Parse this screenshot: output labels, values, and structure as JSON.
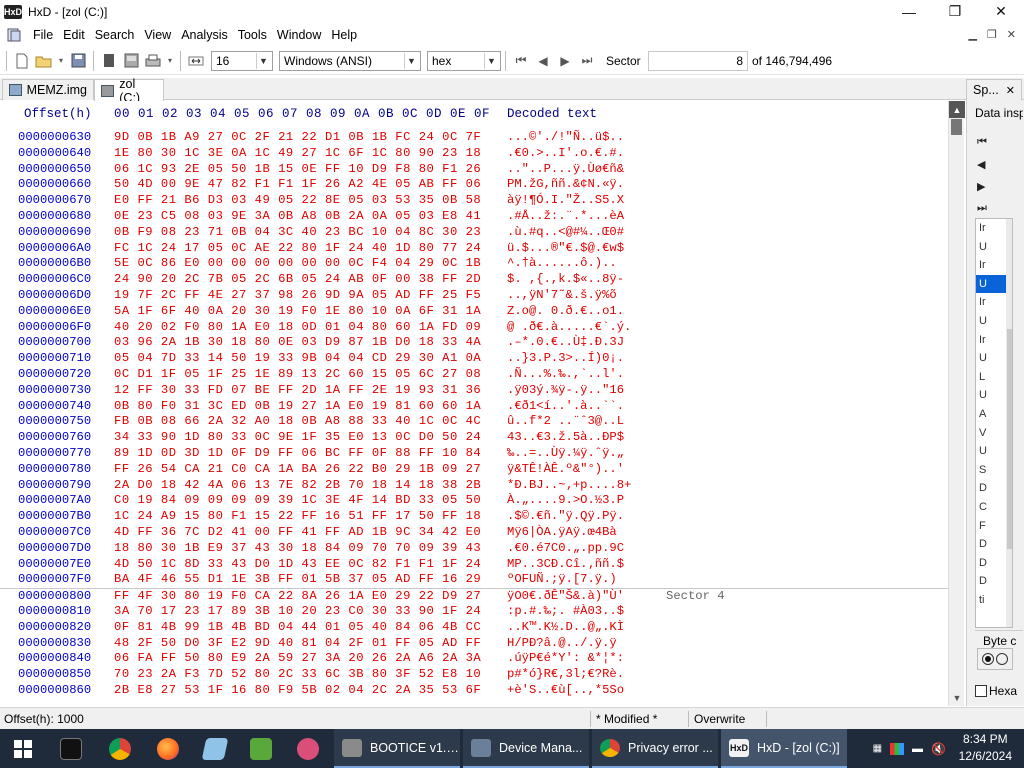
{
  "window": {
    "title": "HxD - [zol (C:)]",
    "app_icon": "HxD",
    "min_glyph": "—",
    "max_glyph": "❐",
    "close_glyph": "✕"
  },
  "menu": [
    "File",
    "Edit",
    "Search",
    "View",
    "Analysis",
    "Tools",
    "Window",
    "Help"
  ],
  "toolbar": {
    "bytes_per_row": "16",
    "charset": "Windows (ANSI)",
    "display_mode": "hex",
    "unit_label": "Sector",
    "sector_value": "8",
    "sector_total": "of 146,794,496"
  },
  "tabs": [
    {
      "label": "MEMZ.img",
      "active": false
    },
    {
      "label": "zol (C:)",
      "active": true
    }
  ],
  "side_tab": {
    "label": "Sp...",
    "close": "✕"
  },
  "editor": {
    "header_offset": "Offset(h)",
    "header_cols": "00 01 02 03 04 05 06 07 08 09 0A 0B 0C 0D 0E 0F",
    "header_text": "Decoded text",
    "rows": [
      {
        "off": "0000000630",
        "hex": "9D 0B 1B A9 27 0C 2F 21 22 D1 0B 1B FC 24 0C 7F",
        "txt": "...©'./!\"Ñ..ü$..",
        "cmt": ""
      },
      {
        "off": "0000000640",
        "hex": "1E 80 30 1C 3E 0A 1C 49 27 1C 6F 1C 80 90 23 18",
        "txt": ".€0.>..I'.o.€.#.",
        "cmt": ""
      },
      {
        "off": "0000000650",
        "hex": "06 1C 93 2E 05 50 1B 15 0E FF 10 D9 F8 80 F1 26",
        "txt": "..\"..P...ÿ.Ùø€ñ&",
        "cmt": ""
      },
      {
        "off": "0000000660",
        "hex": "50 4D 00 9E 47 82 F1 F1 1F 26 A2 4E 05 AB FF 06",
        "txt": "PM.žG,ññ.&¢N.«ÿ.",
        "cmt": ""
      },
      {
        "off": "0000000670",
        "hex": "E0 FF 21 B6 D3 03 49 05 22 8E 05 03 53 35 0B 58",
        "txt": "àÿ!¶Ó.I.\"Ž..S5.X",
        "cmt": ""
      },
      {
        "off": "0000000680",
        "hex": "0E 23 C5 08 03 9E 3A 0B A8 0B 2A 0A 05 03 E8 41",
        "txt": ".#Å..ž:.¨.*...èA",
        "cmt": ""
      },
      {
        "off": "0000000690",
        "hex": "0B F9 08 23 71 0B 04 3C 40 23 BC 10 04 8C 30 23",
        "txt": ".ù.#q..<@#¼..Œ0#",
        "cmt": ""
      },
      {
        "off": "00000006A0",
        "hex": "FC 1C 24 17 05 0C AE 22 80 1F 24 40 1D 80 77 24",
        "txt": "ü.$...®\"€.$@.€w$",
        "cmt": ""
      },
      {
        "off": "00000006B0",
        "hex": "5E 0C 86 E0 00 00 00 00 00 00 0C F4 04 29 0C 1B",
        "txt": "^.†à......ô.)..",
        "cmt": ""
      },
      {
        "off": "00000006C0",
        "hex": "24 90 20 2C 7B 05 2C 6B 05 24 AB 0F 00 38 FF 2D",
        "txt": "$. ,{.,k.$«..8ÿ-",
        "cmt": ""
      },
      {
        "off": "00000006D0",
        "hex": "19 7F 2C FF 4E 27 37 98 26 9D 9A 05 AD FF 25 F5",
        "txt": "..,ÿN'7˜&.š.­ÿ%õ",
        "cmt": ""
      },
      {
        "off": "00000006E0",
        "hex": "5A 1F 6F 40 0A 20 30 19 F0 1E 80 10 0A 6F 31 1A",
        "txt": "Z.o@. 0.ð.€..o1.",
        "cmt": ""
      },
      {
        "off": "00000006F0",
        "hex": "40 20 02 F0 80 1A E0 18 0D 01 04 80 60 1A FD 09",
        "txt": "@ .ð€.à.....€`.ý.",
        "cmt": ""
      },
      {
        "off": "0000000700",
        "hex": "03 96 2A 1B 30 18 80 0E 03 D9 87 1B D0 18 33 4A",
        "txt": ".–*.0.€..Ù‡.Ð.3J",
        "cmt": ""
      },
      {
        "off": "0000000710",
        "hex": "05 04 7D 33 14 50 19 33 9B 04 04 CD 29 30 A1 0A",
        "txt": "..}3.P.3>..Í)0¡.",
        "cmt": ""
      },
      {
        "off": "0000000720",
        "hex": "0C D1 1F 05 1F 25 1E 89 13 2C 60 15 05 6C 27 08",
        "txt": ".Ñ...%.‰.,`..l'.",
        "cmt": ""
      },
      {
        "off": "0000000730",
        "hex": "12 FF 30 33 FD 07 BE FF 2D 1A FF 2E 19 93 31 36",
        "txt": ".ÿ03ý.¾ÿ-.ÿ..\"16",
        "cmt": ""
      },
      {
        "off": "0000000740",
        "hex": "0B 80 F0 31 3C ED 0B 19 27 1A E0 19 81 60 60 1A",
        "txt": ".€ð1<í..'.à..``.",
        "cmt": ""
      },
      {
        "off": "0000000750",
        "hex": "FB 0B 08 66 2A 32 A0 18 0B A8 88 33 40 1C 0C 4C",
        "txt": "û..f*2 ..¨ˆ3@..L",
        "cmt": ""
      },
      {
        "off": "0000000760",
        "hex": "34 33 90 1D 80 33 0C 9E 1F 35 E0 13 0C D0 50 24",
        "txt": "43..€3.ž.5à..ÐP$",
        "cmt": ""
      },
      {
        "off": "0000000770",
        "hex": "89 1D 0D 3D 1D 0F D9 FF 06 BC FF 0F 88 FF 10 84",
        "txt": "‰..=..Ùÿ.¼ÿ.ˆÿ.„",
        "cmt": ""
      },
      {
        "off": "0000000780",
        "hex": "FF 26 54 CA 21 C0 CA 1A BA 26 22 B0 29 1B 09 27",
        "txt": "ÿ&TÊ!ÀÊ.º&\"°)..'",
        "cmt": ""
      },
      {
        "off": "0000000790",
        "hex": "2A D0 18 42 4A 06 13 7E 82 2B 70 18 14 18 38 2B",
        "txt": "*Ð.BJ..~‚+p....8+",
        "cmt": ""
      },
      {
        "off": "00000007A0",
        "hex": "C0 19 84 09 09 09 09 39 1C 3E 4F 14 BD 33 05 50",
        "txt": "À.„....9.>O.½3.P",
        "cmt": ""
      },
      {
        "off": "00000007B0",
        "hex": "1C 24 A9 15 80 F1 15 22 FF 16 51 FF 17 50 FF 18",
        "txt": ".$©.€ñ.\"ÿ.Qÿ.Pÿ.",
        "cmt": ""
      },
      {
        "off": "00000007C0",
        "hex": "4D FF 36 7C D2 41 00 FF 41 FF AD 1B 9C 34 42 E0",
        "txt": "Mÿ6|ÒA.ÿAÿ­.œ4Bà",
        "cmt": ""
      },
      {
        "off": "00000007D0",
        "hex": "18 80 30 1B E9 37 43 30 18 84 09 70 70 09 39 43",
        "txt": ".€0.é7C0.„.pp.9C",
        "cmt": ""
      },
      {
        "off": "00000007E0",
        "hex": "4D 50 1C 8D 33 43 D0 1D 43 EE 0C 82 F1 F1 1F 24",
        "txt": "MP..3CÐ.Cî.‚ññ.$",
        "cmt": ""
      },
      {
        "off": "00000007F0",
        "hex": "BA 4F 46 55 D1 1E 3B FF 01 5B 37 05 AD FF 16 29",
        "txt": "ºOFUÑ.;ÿ.[7.­ÿ.)",
        "cmt": ""
      },
      {
        "off": "0000000800",
        "hex": "FF 4F 30 80 19 F0 CA 22 8A 26 1A E0 29 22 D9 27",
        "txt": "ÿO0€.ðÊ\"Š&.à)\"Ù'",
        "cmt": "Sector 4"
      },
      {
        "off": "0000000810",
        "hex": "3A 70 17 23 17 89 3B 10 20 23 C0 30 33 90 1F 24",
        "txt": ":p.#.‰;. #À03..$",
        "cmt": ""
      },
      {
        "off": "0000000820",
        "hex": "0F 81 4B 99 1B 4B BD 04 44 01 05 40 84 06 4B CC",
        "txt": "..K™.K½.D..@„.KÌ",
        "cmt": ""
      },
      {
        "off": "0000000830",
        "hex": "48 2F 50 D0 3F E2 9D 40 81 04 2F 01 FF 05 AD FF",
        "txt": "H/PÐ?â.@../.ÿ.­ÿ",
        "cmt": ""
      },
      {
        "off": "0000000840",
        "hex": "06 FA FF 50 80 E9 2A 59 27 3A 20 26 2A A6 2A 3A",
        "txt": ".úÿP€é*Y': &*¦*:",
        "cmt": ""
      },
      {
        "off": "0000000850",
        "hex": "70 23 2A F3 7D 52 80 2C 33 6C 3B 80 3F 52 E8 10",
        "txt": "p#*ó}R€,3l;€?Rè.",
        "cmt": ""
      },
      {
        "off": "0000000860",
        "hex": "2B E8 27 53 1F 16 80 F9 5B 02 04 2C 2A 35 53 6F",
        "txt": "+è'S..€ù[..,*5So",
        "cmt": ""
      }
    ]
  },
  "inspector": {
    "title": "Data insp",
    "items": [
      "Ir",
      "U",
      "Ir",
      "U",
      "Ir",
      "U",
      "Ir",
      "U",
      "L",
      "U",
      "A",
      "V",
      "U",
      "S",
      "D",
      "C",
      "F",
      "D",
      "D",
      "D",
      "ti"
    ],
    "selected_index": 3,
    "byte_order_label": "Byte c",
    "hex_label": "Hexa"
  },
  "status": {
    "offset": "Offset(h): 1000",
    "modified": "* Modified *",
    "mode": "Overwrite"
  },
  "taskbar": {
    "windows": [
      {
        "label": "BOOTICE v1.3...",
        "color": "#8a8a8a",
        "active": false
      },
      {
        "label": "Device Mana...",
        "color": "#6a7f9a",
        "active": false
      },
      {
        "label": "Privacy error ...",
        "color": "#e34133",
        "active": false
      },
      {
        "label": "HxD - [zol (C:)]",
        "color": "#333333",
        "active": true
      }
    ],
    "time": "8:34 PM",
    "date": "12/6/2024"
  }
}
